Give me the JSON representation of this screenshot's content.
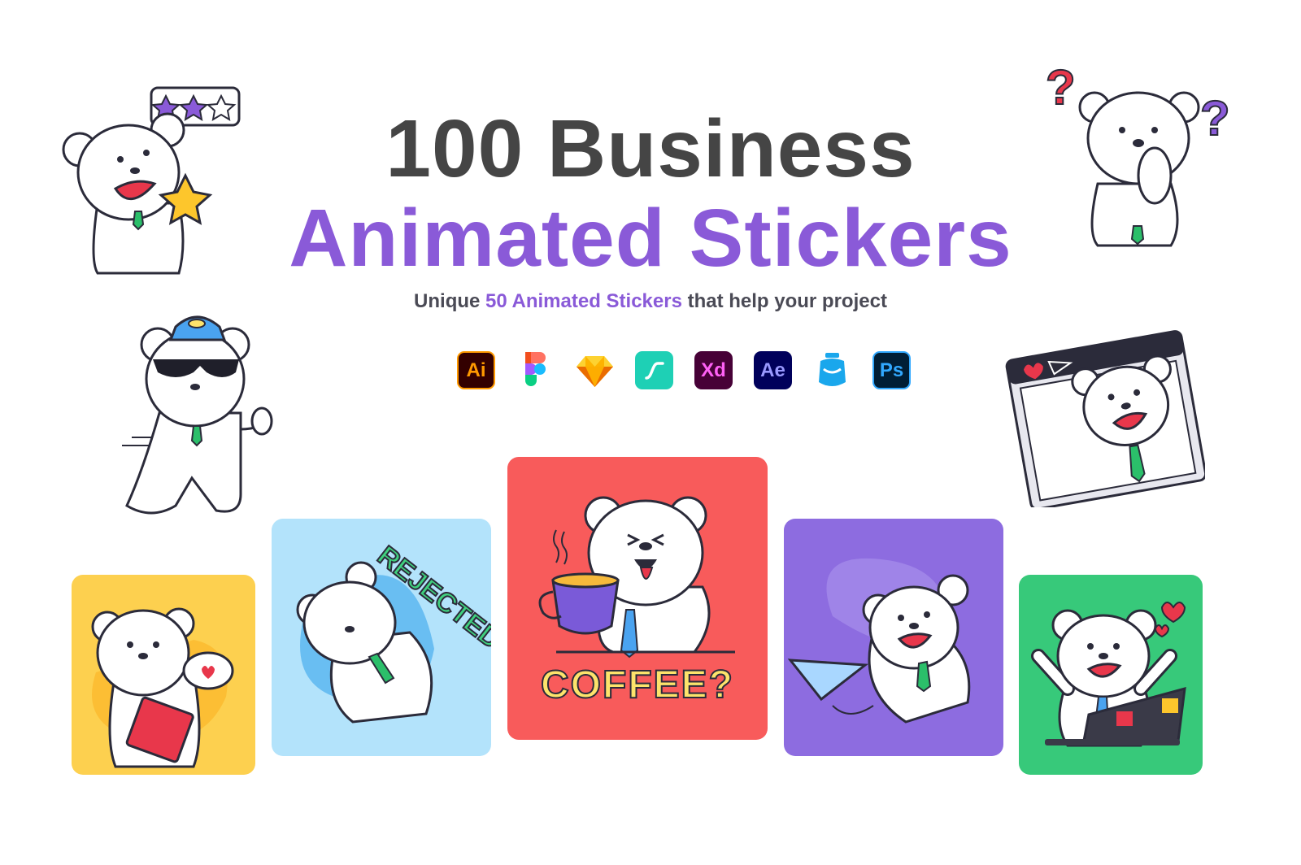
{
  "title": {
    "line1": "100 Business",
    "line2": "Animated Stickers",
    "line1_color": "#454545",
    "line2_color": "#8a5ad8"
  },
  "subtitle": {
    "prefix": "Unique ",
    "highlight": "50 Animated Stickers",
    "suffix": " that help your project",
    "highlight_color": "#8a5ad8"
  },
  "tools": [
    {
      "name": "illustrator-icon",
      "label": "Ai",
      "bg": "#330000",
      "fg": "#ff9a00"
    },
    {
      "name": "figma-icon",
      "label": "",
      "bg": "",
      "fg": ""
    },
    {
      "name": "sketch-icon",
      "label": "",
      "bg": "",
      "fg": ""
    },
    {
      "name": "lottie-icon",
      "label": "",
      "bg": "#1ed0b5",
      "fg": "#ffffff"
    },
    {
      "name": "xd-icon",
      "label": "Xd",
      "bg": "#470137",
      "fg": "#ff61f6"
    },
    {
      "name": "after-effects-icon",
      "label": "Ae",
      "bg": "#00005b",
      "fg": "#9999ff"
    },
    {
      "name": "jar-icon",
      "label": "",
      "bg": "",
      "fg": ""
    },
    {
      "name": "photoshop-icon",
      "label": "Ps",
      "bg": "#001e36",
      "fg": "#31a8ff"
    }
  ],
  "stickers": {
    "rejected_text": "REJECTED..",
    "coffee_text": "COFFEE?"
  },
  "colors": {
    "card_yellow": "#fdd04f",
    "card_blue": "#b3e3fb",
    "card_red": "#f85b5b",
    "card_purple": "#8d6ce0",
    "card_green": "#37c97a",
    "bear_outline": "#2b2b3a",
    "tie_green": "#2bbf6a"
  }
}
